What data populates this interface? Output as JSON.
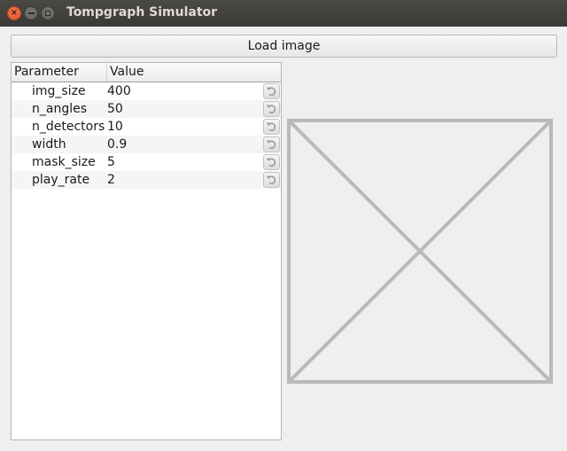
{
  "window": {
    "title": "Tompgraph Simulator"
  },
  "toolbar": {
    "load_image_label": "Load image"
  },
  "tree": {
    "columns": {
      "parameter": "Parameter",
      "value": "Value"
    },
    "rows": [
      {
        "name": "img_size",
        "value": "400"
      },
      {
        "name": "n_angles",
        "value": "50"
      },
      {
        "name": "n_detectors",
        "value": "10"
      },
      {
        "name": "width",
        "value": "0.9"
      },
      {
        "name": "mask_size",
        "value": "5"
      },
      {
        "name": "play_rate",
        "value": "2"
      }
    ]
  },
  "icons": {
    "close": "close-icon",
    "minimize": "minimize-icon",
    "maximize": "maximize-icon",
    "reset": "reset-arrow-icon",
    "image_placeholder": "image-placeholder-icon"
  },
  "colors": {
    "titlebar": "#3c3b37",
    "close_button": "#e9602f",
    "background": "#efefef",
    "placeholder_stroke": "#b9b9b9"
  }
}
